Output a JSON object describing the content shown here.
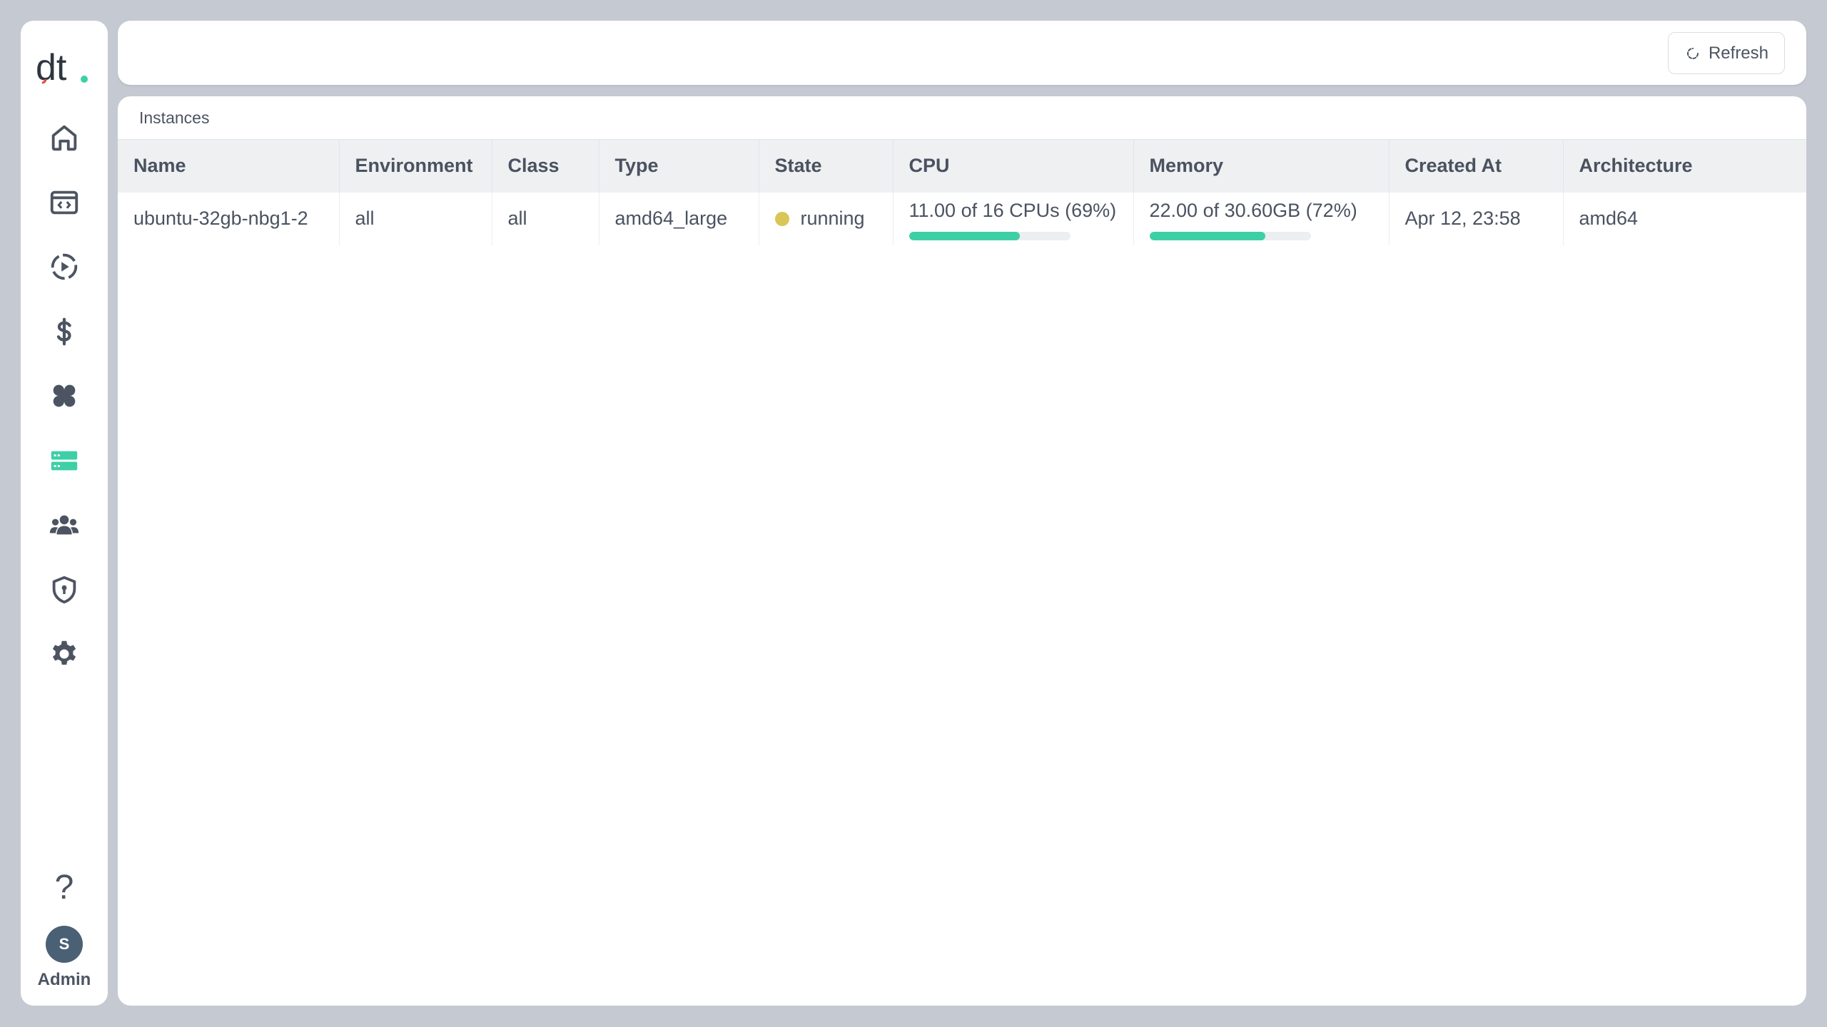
{
  "app": {
    "logo_text": "dt"
  },
  "sidebar": {
    "items": [
      {
        "name": "home",
        "icon": "home-icon"
      },
      {
        "name": "code-window",
        "icon": "code-window-icon"
      },
      {
        "name": "runs",
        "icon": "play-circle-icon"
      },
      {
        "name": "billing",
        "icon": "dollar-icon"
      },
      {
        "name": "apps",
        "icon": "clover-icon"
      },
      {
        "name": "instances",
        "icon": "server-icon",
        "active": true
      },
      {
        "name": "users",
        "icon": "users-icon"
      },
      {
        "name": "security",
        "icon": "shield-icon"
      },
      {
        "name": "settings",
        "icon": "gear-icon"
      }
    ],
    "help_label": "?",
    "avatar_initial": "S",
    "user_name": "Admin"
  },
  "topbar": {
    "refresh_label": "Refresh"
  },
  "panel": {
    "title": "Instances",
    "columns": [
      "Name",
      "Environment",
      "Class",
      "Type",
      "State",
      "CPU",
      "Memory",
      "Created At",
      "Architecture"
    ],
    "rows": [
      {
        "name": "ubuntu-32gb-nbg1-2",
        "environment": "all",
        "class": "all",
        "type": "amd64_large",
        "state": "running",
        "cpu_text": "11.00 of 16 CPUs (69%)",
        "cpu_percent": 69,
        "memory_text": "22.00 of 30.60GB (72%)",
        "memory_percent": 72,
        "created_at": "Apr 12, 23:58",
        "architecture": "amd64"
      }
    ]
  },
  "colors": {
    "accent": "#3ecfa6",
    "state_running": "#d9c657",
    "icon": "#4c5462",
    "background": "#c4c9d2"
  }
}
